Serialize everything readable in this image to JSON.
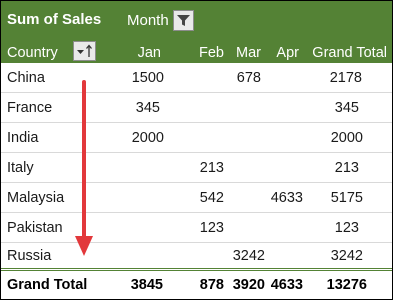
{
  "pivot": {
    "header": {
      "values_label": "Sum of Sales",
      "column_field": "Month",
      "row_field": "Country",
      "months": [
        "Jan",
        "Feb",
        "Mar",
        "Apr"
      ],
      "grand_total": "Grand Total"
    },
    "rows": [
      {
        "country": "China",
        "jan": "1500",
        "feb": "",
        "mar": "678",
        "apr": "",
        "total": "2178"
      },
      {
        "country": "France",
        "jan": "345",
        "feb": "",
        "mar": "",
        "apr": "",
        "total": "345"
      },
      {
        "country": "India",
        "jan": "2000",
        "feb": "",
        "mar": "",
        "apr": "",
        "total": "2000"
      },
      {
        "country": "Italy",
        "jan": "",
        "feb": "213",
        "mar": "",
        "apr": "",
        "total": "213"
      },
      {
        "country": "Malaysia",
        "jan": "",
        "feb": "542",
        "mar": "",
        "apr": "4633",
        "total": "5175"
      },
      {
        "country": "Pakistan",
        "jan": "",
        "feb": "123",
        "mar": "",
        "apr": "",
        "total": "123"
      },
      {
        "country": "Russia",
        "jan": "",
        "feb": "",
        "mar": "3242",
        "apr": "",
        "total": "3242"
      }
    ],
    "total_row": {
      "label": "Grand Total",
      "jan": "3845",
      "feb": "878",
      "mar": "3920",
      "apr": "4633",
      "total": "13276"
    },
    "colors": {
      "header_bg": "#548235",
      "arrow": "#e2383b",
      "accent_line": "#548235"
    },
    "icons": {
      "month_filter": "filter-icon",
      "country_sort": "sort-dropdown-icon"
    }
  }
}
